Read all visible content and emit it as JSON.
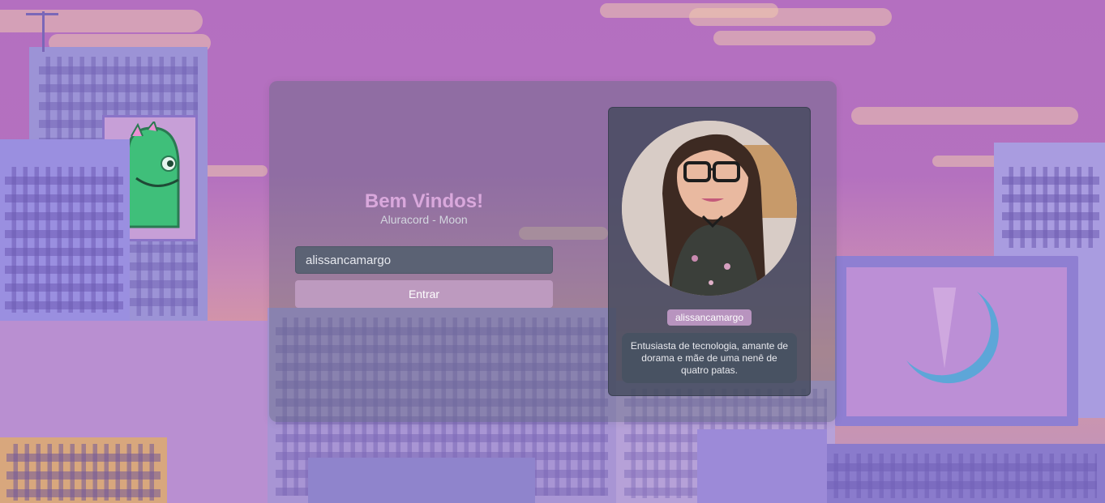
{
  "login": {
    "title": "Bem Vindos!",
    "subtitle": "Aluracord - Moon",
    "username_value": "alissancamargo",
    "submit_label": "Entrar"
  },
  "profile": {
    "username": "alissancamargo",
    "bio": "Entusiasta de tecnologia, amante de dorama e mãe de uma nenê de quatro patas."
  },
  "colors": {
    "title": "#d9a8dc",
    "button": "#bd9abf",
    "badge": "#b894bf"
  }
}
